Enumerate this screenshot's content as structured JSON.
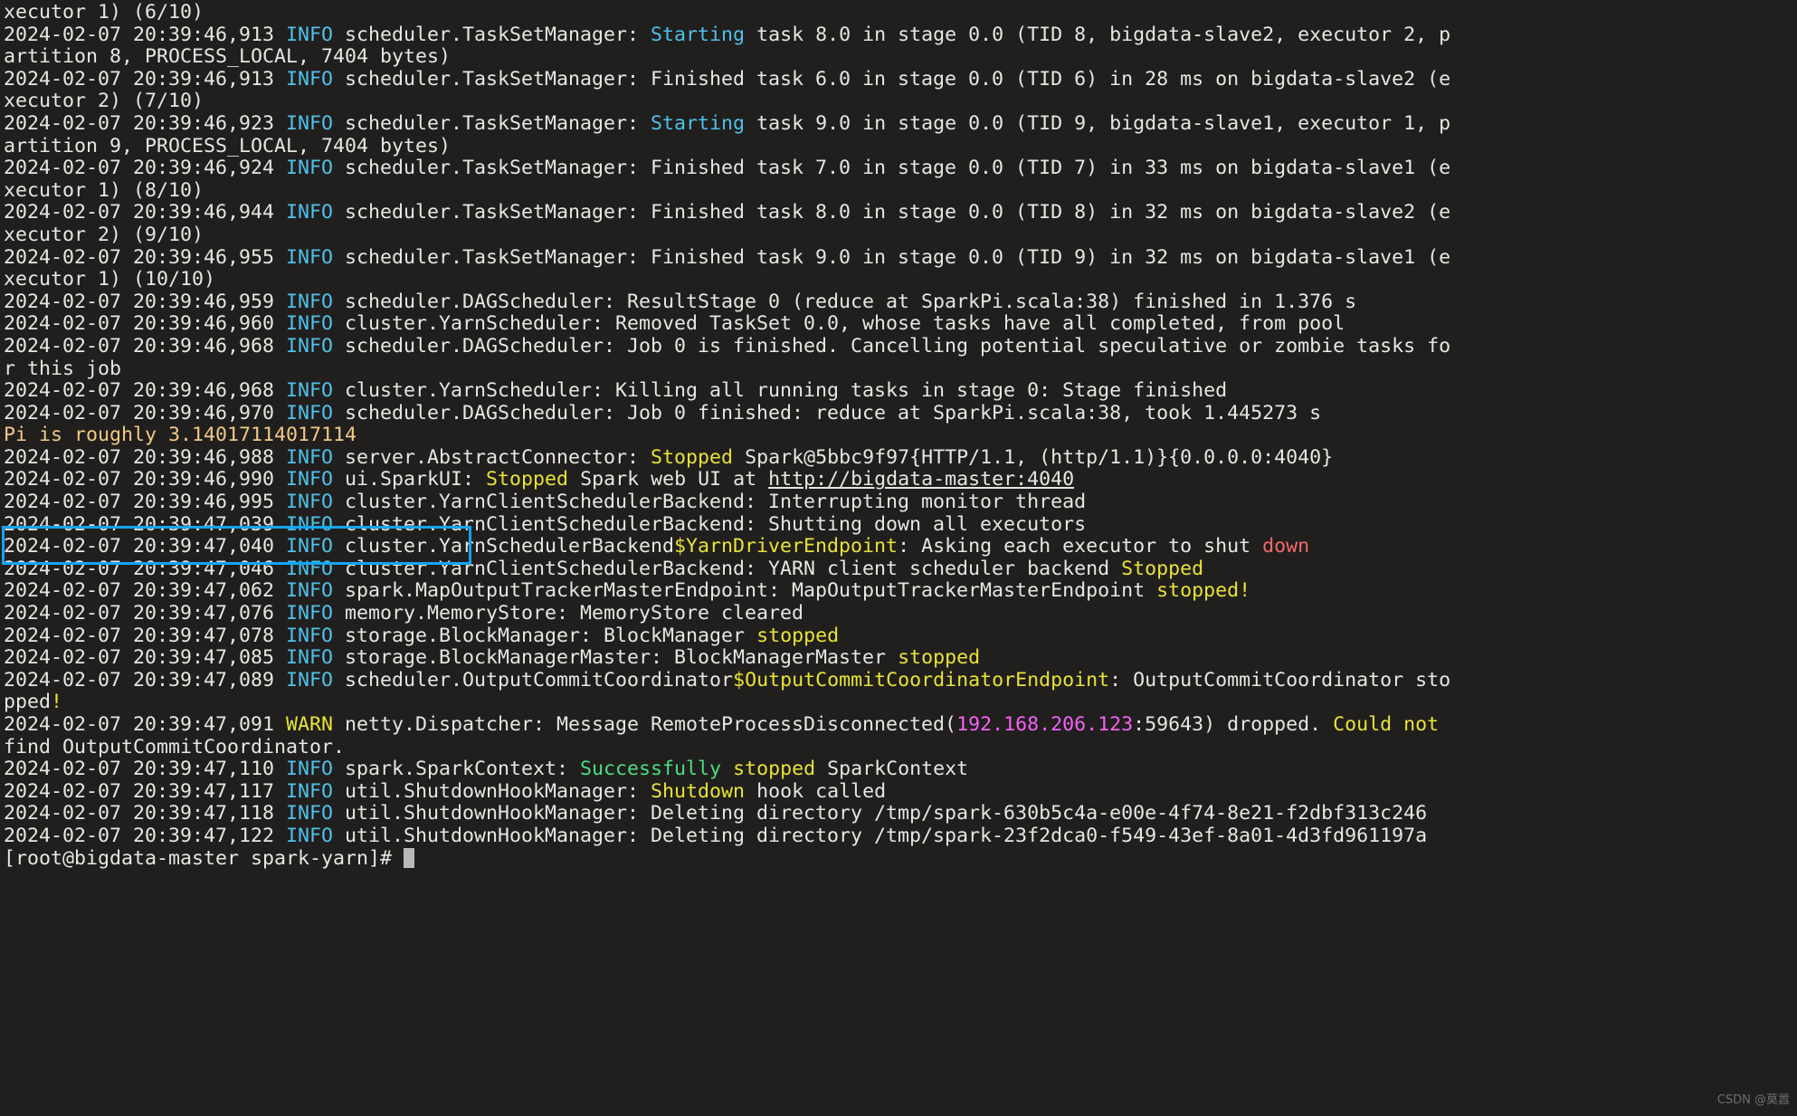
{
  "terminal": {
    "background_color": "#211f1e",
    "foreground_color": "#e8e6e3",
    "info_color": "#4fc1e9",
    "warn_color": "#e8e337",
    "highlight_border_color": "#12a5ef",
    "pi_text_color": "#f0c987",
    "error_color": "#f06a6a",
    "success_color": "#4ade80",
    "ip_color": "#f562f5",
    "prompt": "[root@bigdata-master spark-yarn]# ",
    "watermark": "CSDN @莫嚣"
  },
  "lines": {
    "l01": "xecutor 1) (6/10)",
    "l02a": "2024-02-07 20:39:46,913 ",
    "l02b": "INFO",
    "l02c": " scheduler.TaskSetManager: ",
    "l02d": "Starting",
    "l02e": " task 8.0 in stage 0.0 (TID 8, bigdata-slave2, executor 2, p",
    "l03": "artition 8, PROCESS_LOCAL, 7404 bytes)",
    "l04a": "2024-02-07 20:39:46,913 ",
    "l04b": "INFO",
    "l04c": " scheduler.TaskSetManager: Finished task 6.0 in stage 0.0 (TID 6) in 28 ms on bigdata-slave2 (e",
    "l05": "xecutor 2) (7/10)",
    "l06a": "2024-02-07 20:39:46,923 ",
    "l06b": "INFO",
    "l06c": " scheduler.TaskSetManager: ",
    "l06d": "Starting",
    "l06e": " task 9.0 in stage 0.0 (TID 9, bigdata-slave1, executor 1, p",
    "l07": "artition 9, PROCESS_LOCAL, 7404 bytes)",
    "l08a": "2024-02-07 20:39:46,924 ",
    "l08b": "INFO",
    "l08c": " scheduler.TaskSetManager: Finished task 7.0 in stage 0.0 (TID 7) in 33 ms on bigdata-slave1 (e",
    "l09": "xecutor 1) (8/10)",
    "l10a": "2024-02-07 20:39:46,944 ",
    "l10b": "INFO",
    "l10c": " scheduler.TaskSetManager: Finished task 8.0 in stage 0.0 (TID 8) in 32 ms on bigdata-slave2 (e",
    "l11": "xecutor 2) (9/10)",
    "l12a": "2024-02-07 20:39:46,955 ",
    "l12b": "INFO",
    "l12c": " scheduler.TaskSetManager: Finished task 9.0 in stage 0.0 (TID 9) in 32 ms on bigdata-slave1 (e",
    "l13": "xecutor 1) (10/10)",
    "l14a": "2024-02-07 20:39:46,959 ",
    "l14b": "INFO",
    "l14c": " scheduler.DAGScheduler: ResultStage 0 (reduce at SparkPi.scala:38) finished in 1.376 s",
    "l15a": "2024-02-07 20:39:46,960 ",
    "l15b": "INFO",
    "l15c": " cluster.YarnScheduler: Removed TaskSet 0.0, whose tasks have all completed, from pool",
    "l16a": "2024-02-07 20:39:46,968 ",
    "l16b": "INFO",
    "l16c": " scheduler.DAGScheduler: Job 0 is finished. Cancelling potential speculative or zombie tasks fo",
    "l17": "r this job",
    "l18a": "2024-02-07 20:39:46,968 ",
    "l18b": "INFO",
    "l18c": " cluster.YarnScheduler: Killing all running tasks in stage 0: Stage finished",
    "l19a": "2024-02-07 20:39:46,970 ",
    "l19b": "INFO",
    "l19c": " scheduler.DAGScheduler: Job 0 finished: reduce at SparkPi.scala:38, took 1.445273 s",
    "l20": "Pi is roughly 3.14017114017114",
    "l21a": "2024-02-07 20:39:46,988 ",
    "l21b": "INFO",
    "l21c": " server.AbstractConnector: ",
    "l21d": "Stopped",
    "l21e": " Spark@5bbc9f97{HTTP/1.1, (http/1.1)}{0.0.0.0:4040}",
    "l22a": "2024-02-07 20:39:46,990 ",
    "l22b": "INFO",
    "l22c": " ui.SparkUI: ",
    "l22d": "Stopped",
    "l22e": " Spark web UI at ",
    "l22f": "http://bigdata-master:4040",
    "l23a": "2024-02-07 20:39:46,995 ",
    "l23b": "INFO",
    "l23c": " cluster.YarnClientSchedulerBackend: Interrupting monitor thread",
    "l24a": "2024-02-07 20:39:47,039 ",
    "l24b": "INFO",
    "l24c": " cluster.YarnClientSchedulerBackend: Shutting down all executors",
    "l25a": "2024-02-07 20:39:47,040 ",
    "l25b": "INFO",
    "l25c": " cluster.YarnSchedulerBackend",
    "l25d": "$YarnDriverEndpoint",
    "l25e": ": Asking each executor to shut ",
    "l25f": "down",
    "l26a": "2024-02-07 20:39:47,046 ",
    "l26b": "INFO",
    "l26c": " cluster.YarnClientSchedulerBackend: YARN client scheduler backend ",
    "l26d": "Stopped",
    "l27a": "2024-02-07 20:39:47,062 ",
    "l27b": "INFO",
    "l27c": " spark.MapOutputTrackerMasterEndpoint: MapOutputTrackerMasterEndpoint ",
    "l27d": "stopped!",
    "l28a": "2024-02-07 20:39:47,076 ",
    "l28b": "INFO",
    "l28c": " memory.MemoryStore: MemoryStore cleared",
    "l29a": "2024-02-07 20:39:47,078 ",
    "l29b": "INFO",
    "l29c": " storage.BlockManager: BlockManager ",
    "l29d": "stopped",
    "l30a": "2024-02-07 20:39:47,085 ",
    "l30b": "INFO",
    "l30c": " storage.BlockManagerMaster: BlockManagerMaster ",
    "l30d": "stopped",
    "l31a": "2024-02-07 20:39:47,089 ",
    "l31b": "INFO",
    "l31c": " scheduler.OutputCommitCoordinator",
    "l31d": "$OutputCommitCoordinatorEndpoint",
    "l31e": ": OutputCommitCoordinator sto",
    "l32a": "pped",
    "l32b": "!",
    "l33a": "2024-02-07 20:39:47,091 ",
    "l33b": "WARN",
    "l33c": " netty.Dispatcher: Message RemoteProcessDisconnected(",
    "l33d": "192.168.206.123",
    "l33e": ":59643) dropped. ",
    "l33f": "Could not",
    "l34": "find OutputCommitCoordinator.",
    "l35a": "2024-02-07 20:39:47,110 ",
    "l35b": "INFO",
    "l35c": " spark.SparkContext: ",
    "l35d": "Successfully",
    "l35e": " ",
    "l35f": "stopped",
    "l35g": " SparkContext",
    "l36a": "2024-02-07 20:39:47,117 ",
    "l36b": "INFO",
    "l36c": " util.ShutdownHookManager: ",
    "l36d": "Shutdown",
    "l36e": " hook called",
    "l37a": "2024-02-07 20:39:47,118 ",
    "l37b": "INFO",
    "l37c": " util.ShutdownHookManager: Deleting directory /tmp/spark-630b5c4a-e00e-4f74-8e21-f2dbf313c246",
    "l38a": "2024-02-07 20:39:47,122 ",
    "l38b": "INFO",
    "l38c": " util.ShutdownHookManager: Deleting directory /tmp/spark-23f2dca0-f549-43ef-8a01-4d3fd961197a",
    "l39": "[root@bigdata-master spark-yarn]# "
  }
}
